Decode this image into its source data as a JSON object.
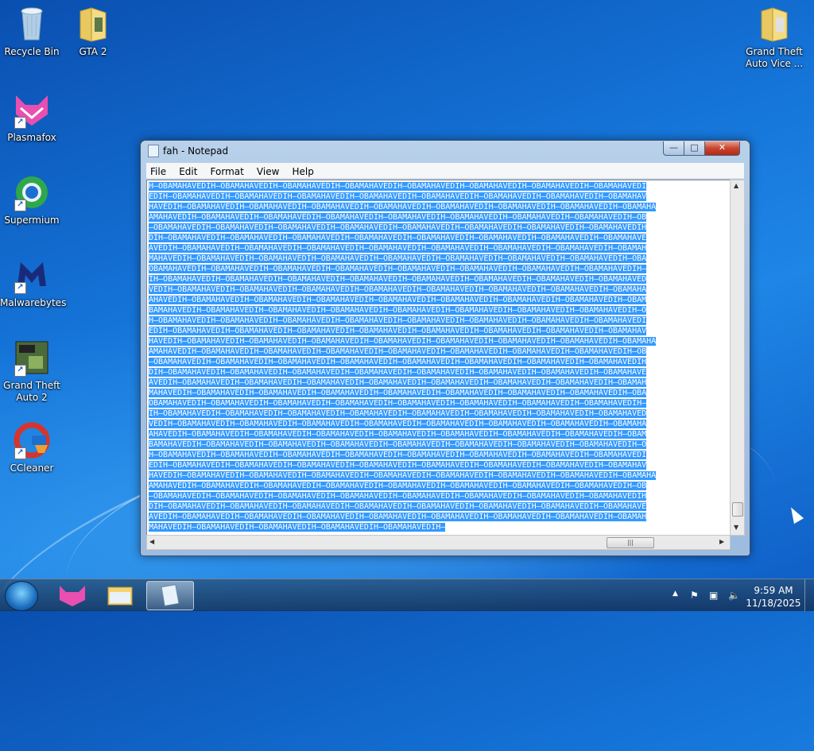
{
  "desktop": {
    "icons": [
      {
        "label": "Recycle Bin",
        "icon": "recycle-bin-icon"
      },
      {
        "label": "GTA 2",
        "icon": "folder-icon"
      },
      {
        "label": "Grand Theft Auto Vice ...",
        "icon": "folder-icon"
      },
      {
        "label": "Plasmafox",
        "icon": "plasmafox-icon"
      },
      {
        "label": "Supermium",
        "icon": "supermium-icon"
      },
      {
        "label": "Malwarebytes",
        "icon": "malwarebytes-icon"
      },
      {
        "label": "Grand Theft Auto 2",
        "icon": "gta2-game-icon"
      },
      {
        "label": "CCleaner",
        "icon": "ccleaner-icon"
      }
    ]
  },
  "notepad": {
    "title": "fah - Notepad",
    "menu": [
      "File",
      "Edit",
      "Format",
      "View",
      "Help"
    ],
    "window_controls": {
      "minimize": "—",
      "maximize": "□",
      "close": "✕"
    },
    "selection_color": "#3399ff",
    "lines": [
      "H–OBAMAHAVEDIH–OBAMAHAVEDIH–OBAMAHAVEDIH–OBAMAHAVEDIH–OBAMAHAVEDIH–OBAMAHAVEDIH–OBAMAHAVEDIH–OBAMAHAVEDI",
      "EDIH–OBAMAHAVEDIH–OBAMAHAVEDIH–OBAMAHAVEDIH–OBAMAHAVEDIH–OBAMAHAVEDIH–OBAMAHAVEDIH–OBAMAHAVEDIH–OBAMAHAV",
      "HAVEDIH–OBAMAHAVEDIH–OBAMAHAVEDIH–OBAMAHAVEDIH–OBAMAHAVEDIH–OBAMAHAVEDIH–OBAMAHAVEDIH–OBAMAHAVEDIH–OBAMAHA",
      "AMAHAVEDIH–OBAMAHAVEDIH–OBAMAHAVEDIH–OBAMAHAVEDIH–OBAMAHAVEDIH–OBAMAHAVEDIH–OBAMAHAVEDIH–OBAMAHAVEDIH–OB",
      "–OBAMAHAVEDIH–OBAMAHAVEDIH–OBAMAHAVEDIH–OBAMAHAVEDIH–OBAMAHAVEDIH–OBAMAHAVEDIH–OBAMAHAVEDIH–OBAMAHAVEDIH",
      "DIH–OBAMAHAVEDIH–OBAMAHAVEDIH–OBAMAHAVEDIH–OBAMAHAVEDIH–OBAMAHAVEDIH–OBAMAHAVEDIH–OBAMAHAVEDIH–OBAMAHAVE",
      "AVEDIH–OBAMAHAVEDIH–OBAMAHAVEDIH–OBAMAHAVEDIH–OBAMAHAVEDIH–OBAMAHAVEDIH–OBAMAHAVEDIH–OBAMAHAVEDIH–OBAMAH",
      "MAHAVEDIH–OBAMAHAVEDIH–OBAMAHAVEDIH–OBAMAHAVEDIH–OBAMAHAVEDIH–OBAMAHAVEDIH–OBAMAHAVEDIH–OBAMAHAVEDIH–OBA",
      "OBAMAHAVEDIH–OBAMAHAVEDIH–OBAMAHAVEDIH–OBAMAHAVEDIH–OBAMAHAVEDIH–OBAMAHAVEDIH–OBAMAHAVEDIH–OBAMAHAVEDIH–",
      "IH–OBAMAHAVEDIH–OBAMAHAVEDIH–OBAMAHAVEDIH–OBAMAHAVEDIH–OBAMAHAVEDIH–OBAMAHAVEDIH–OBAMAHAVEDIH–OBAMAHAVED",
      "VEDIH–OBAMAHAVEDIH–OBAMAHAVEDIH–OBAMAHAVEDIH–OBAMAHAVEDIH–OBAMAHAVEDIH–OBAMAHAVEDIH–OBAMAHAVEDIH–OBAMAHA",
      "AHAVEDIH–OBAMAHAVEDIH–OBAMAHAVEDIH–OBAMAHAVEDIH–OBAMAHAVEDIH–OBAMAHAVEDIH–OBAMAHAVEDIH–OBAMAHAVEDIH–OBAM",
      "BAMAHAVEDIH–OBAMAHAVEDIH–OBAMAHAVEDIH–OBAMAHAVEDIH–OBAMAHAVEDIH–OBAMAHAVEDIH–OBAMAHAVEDIH–OBAMAHAVEDIH–O",
      "H–OBAMAHAVEDIH–OBAMAHAVEDIH–OBAMAHAVEDIH–OBAMAHAVEDIH–OBAMAHAVEDIH–OBAMAHAVEDIH–OBAMAHAVEDIH–OBAMAHAVEDI",
      "EDIH–OBAMAHAVEDIH–OBAMAHAVEDIH–OBAMAHAVEDIH–OBAMAHAVEDIH–OBAMAHAVEDIH–OBAMAHAVEDIH–OBAMAHAVEDIH–OBAMAHAV",
      "HAVEDIH–OBAMAHAVEDIH–OBAMAHAVEDIH–OBAMAHAVEDIH–OBAMAHAVEDIH–OBAMAHAVEDIH–OBAMAHAVEDIH–OBAMAHAVEDIH–OBAMAHA",
      "AMAHAVEDIH–OBAMAHAVEDIH–OBAMAHAVEDIH–OBAMAHAVEDIH–OBAMAHAVEDIH–OBAMAHAVEDIH–OBAMAHAVEDIH–OBAMAHAVEDIH–OB",
      "–OBAMAHAVEDIH–OBAMAHAVEDIH–OBAMAHAVEDIH–OBAMAHAVEDIH–OBAMAHAVEDIH–OBAMAHAVEDIH–OBAMAHAVEDIH–OBAMAHAVEDIH",
      "DIH–OBAMAHAVEDIH–OBAMAHAVEDIH–OBAMAHAVEDIH–OBAMAHAVEDIH–OBAMAHAVEDIH–OBAMAHAVEDIH–OBAMAHAVEDIH–OBAMAHAVE",
      "AVEDIH–OBAMAHAVEDIH–OBAMAHAVEDIH–OBAMAHAVEDIH–OBAMAHAVEDIH–OBAMAHAVEDIH–OBAMAHAVEDIH–OBAMAHAVEDIH–OBAMAH",
      "MAHAVEDIH–OBAMAHAVEDIH–OBAMAHAVEDIH–OBAMAHAVEDIH–OBAMAHAVEDIH–OBAMAHAVEDIH–OBAMAHAVEDIH–OBAMAHAVEDIH–OBA",
      "OBAMAHAVEDIH–OBAMAHAVEDIH–OBAMAHAVEDIH–OBAMAHAVEDIH–OBAMAHAVEDIH–OBAMAHAVEDIH–OBAMAHAVEDIH–OBAMAHAVEDIH–",
      "IH–OBAMAHAVEDIH–OBAMAHAVEDIH–OBAMAHAVEDIH–OBAMAHAVEDIH–OBAMAHAVEDIH–OBAMAHAVEDIH–OBAMAHAVEDIH–OBAMAHAVED",
      "VEDIH–OBAMAHAVEDIH–OBAMAHAVEDIH–OBAMAHAVEDIH–OBAMAHAVEDIH–OBAMAHAVEDIH–OBAMAHAVEDIH–OBAMAHAVEDIH–OBAMAHA",
      "AHAVEDIH–OBAMAHAVEDIH–OBAMAHAVEDIH–OBAMAHAVEDIH–OBAMAHAVEDIH–OBAMAHAVEDIH–OBAMAHAVEDIH–OBAMAHAVEDIH–OBAM",
      "BAMAHAVEDIH–OBAMAHAVEDIH–OBAMAHAVEDIH–OBAMAHAVEDIH–OBAMAHAVEDIH–OBAMAHAVEDIH–OBAMAHAVEDIH–OBAMAHAVEDIH–O",
      "H–OBAMAHAVEDIH–OBAMAHAVEDIH–OBAMAHAVEDIH–OBAMAHAVEDIH–OBAMAHAVEDIH–OBAMAHAVEDIH–OBAMAHAVEDIH–OBAMAHAVEDI",
      "EDIH–OBAMAHAVEDIH–OBAMAHAVEDIH–OBAMAHAVEDIH–OBAMAHAVEDIH–OBAMAHAVEDIH–OBAMAHAVEDIH–OBAMAHAVEDIH–OBAMAHAV",
      "HAVEDIH–OBAMAHAVEDIH–OBAMAHAVEDIH–OBAMAHAVEDIH–OBAMAHAVEDIH–OBAMAHAVEDIH–OBAMAHAVEDIH–OBAMAHAVEDIH–OBAMAHA",
      "AMAHAVEDIH–OBAMAHAVEDIH–OBAMAHAVEDIH–OBAMAHAVEDIH–OBAMAHAVEDIH–OBAMAHAVEDIH–OBAMAHAVEDIH–OBAMAHAVEDIH–OB",
      "–OBAMAHAVEDIH–OBAMAHAVEDIH–OBAMAHAVEDIH–OBAMAHAVEDIH–OBAMAHAVEDIH–OBAMAHAVEDIH–OBAMAHAVEDIH–OBAMAHAVEDIH",
      "DIH–OBAMAHAVEDIH–OBAMAHAVEDIH–OBAMAHAVEDIH–OBAMAHAVEDIH–OBAMAHAVEDIH–OBAMAHAVEDIH–OBAMAHAVEDIH–OBAMAHAVE",
      "AVEDIH–OBAMAHAVEDIH–OBAMAHAVEDIH–OBAMAHAVEDIH–OBAMAHAVEDIH–OBAMAHAVEDIH–OBAMAHAVEDIH–OBAMAHAVEDIH–OBAMAH",
      "MAHAVEDIH–OBAMAHAVEDIH–OBAMAHAVEDIH–OBAMAHAVEDIH–OBAMAHAVEDIH–"
    ]
  },
  "taskbar": {
    "pinned": [
      {
        "icon": "start-orb-icon"
      },
      {
        "icon": "plasmafox-icon"
      },
      {
        "icon": "file-explorer-icon"
      },
      {
        "icon": "notepad-icon"
      }
    ],
    "tray_icons": [
      "show-hidden-icons-arrow",
      "action-center-flag-icon",
      "network-icon",
      "volume-muted-icon"
    ],
    "clock": {
      "time": "9:59 AM",
      "date": "11/18/2025"
    }
  }
}
